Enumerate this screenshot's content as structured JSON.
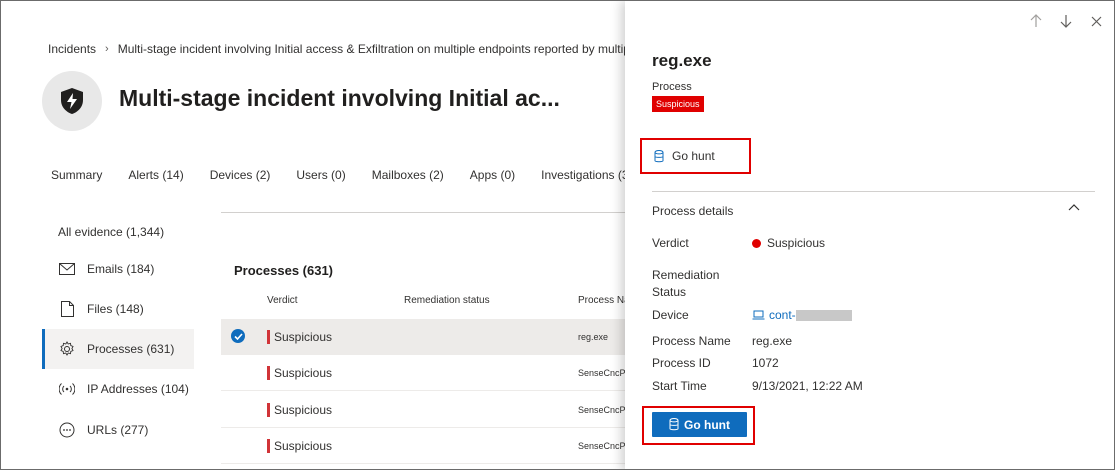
{
  "breadcrumb": {
    "root": "Incidents",
    "current": "Multi-stage incident involving Initial access & Exfiltration on multiple endpoints reported by multip"
  },
  "header": {
    "title": "Multi-stage incident involving Initial ac...",
    "icon": "shield-lightning-icon"
  },
  "tabs": [
    {
      "label": "Summary"
    },
    {
      "label": "Alerts (14)"
    },
    {
      "label": "Devices (2)"
    },
    {
      "label": "Users (0)"
    },
    {
      "label": "Mailboxes (2)"
    },
    {
      "label": "Apps (0)"
    },
    {
      "label": "Investigations (3)"
    }
  ],
  "sidebar": {
    "title": "All evidence (1,344)",
    "items": [
      {
        "label": "Emails (184)",
        "icon": "mail-icon"
      },
      {
        "label": "Files (148)",
        "icon": "file-icon"
      },
      {
        "label": "Processes (631)",
        "icon": "gear-icon"
      },
      {
        "label": "IP Addresses (104)",
        "icon": "broadcast-icon"
      },
      {
        "label": "URLs (277)",
        "icon": "link-icon"
      }
    ]
  },
  "processes": {
    "title": "Processes (631)",
    "columns": [
      "Verdict",
      "Remediation status",
      "Process Na"
    ],
    "rows": [
      {
        "verdict": "Suspicious",
        "process": "reg.exe"
      },
      {
        "verdict": "Suspicious",
        "process": "SenseCncP"
      },
      {
        "verdict": "Suspicious",
        "process": "SenseCncP"
      },
      {
        "verdict": "Suspicious",
        "process": "SenseCncP"
      }
    ]
  },
  "panel": {
    "title": "reg.exe",
    "subtitle": "Process",
    "badge": "Suspicious",
    "go_hunt_link": "Go hunt",
    "section_title": "Process details",
    "details": {
      "verdict_label": "Verdict",
      "verdict_value": "Suspicious",
      "remediation_label": "Remediation Status",
      "device_label": "Device",
      "device_value": "cont-",
      "process_name_label": "Process Name",
      "process_name_value": "reg.exe",
      "process_id_label": "Process ID",
      "process_id_value": "1072",
      "start_time_label": "Start Time",
      "start_time_value": "9/13/2021, 12:22 AM"
    },
    "go_hunt_button": "Go hunt"
  },
  "colors": {
    "accent": "#0f6cbd",
    "suspicious": "#e00000",
    "highlight_box": "#e00000"
  }
}
